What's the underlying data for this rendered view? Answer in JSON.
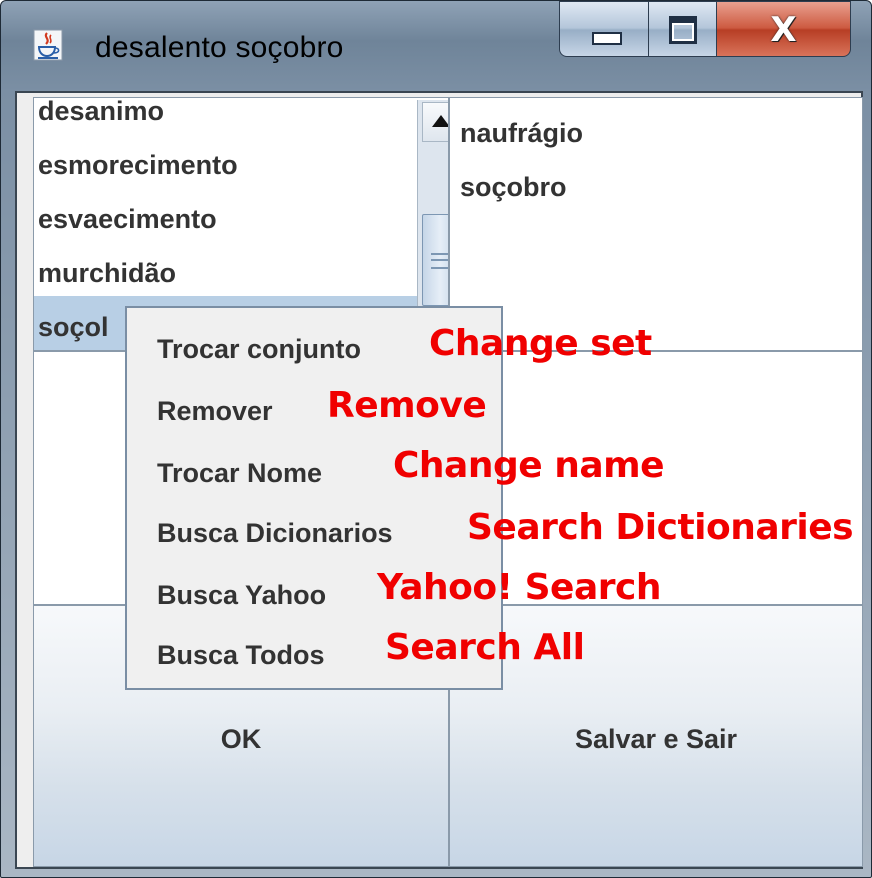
{
  "window": {
    "title": "desalento soçobro",
    "controls": {
      "minimize": "minimize",
      "maximize": "maximize",
      "close": "X"
    }
  },
  "left_list": {
    "items": [
      "desanimo",
      "esmorecimento",
      "esvaecimento",
      "murchidão",
      "soçobro"
    ],
    "selected_index": 4,
    "visible_selected_text": "soçol"
  },
  "right_list": {
    "items": [
      "naufrágio",
      "soçobro"
    ]
  },
  "buttons": {
    "ok": "OK",
    "save_exit": "Salvar e Sair"
  },
  "context_menu": {
    "items": [
      {
        "label": "Trocar conjunto",
        "annotation": "Change set"
      },
      {
        "label": "Remover",
        "annotation": "Remove"
      },
      {
        "label": "Trocar Nome",
        "annotation": "Change name"
      },
      {
        "label": "Busca Dicionarios",
        "annotation": "Search Dictionaries"
      },
      {
        "label": "Busca Yahoo",
        "annotation": "Yahoo! Search"
      },
      {
        "label": "Busca Todos",
        "annotation": "Search All"
      }
    ]
  },
  "colors": {
    "annotation": "#f00000",
    "selection": "#b8cfe5",
    "text": "#333333"
  },
  "icons": {
    "app": "java-cup-icon",
    "scroll_up": "arrow-up-icon",
    "scroll_grip": "grip-icon"
  }
}
